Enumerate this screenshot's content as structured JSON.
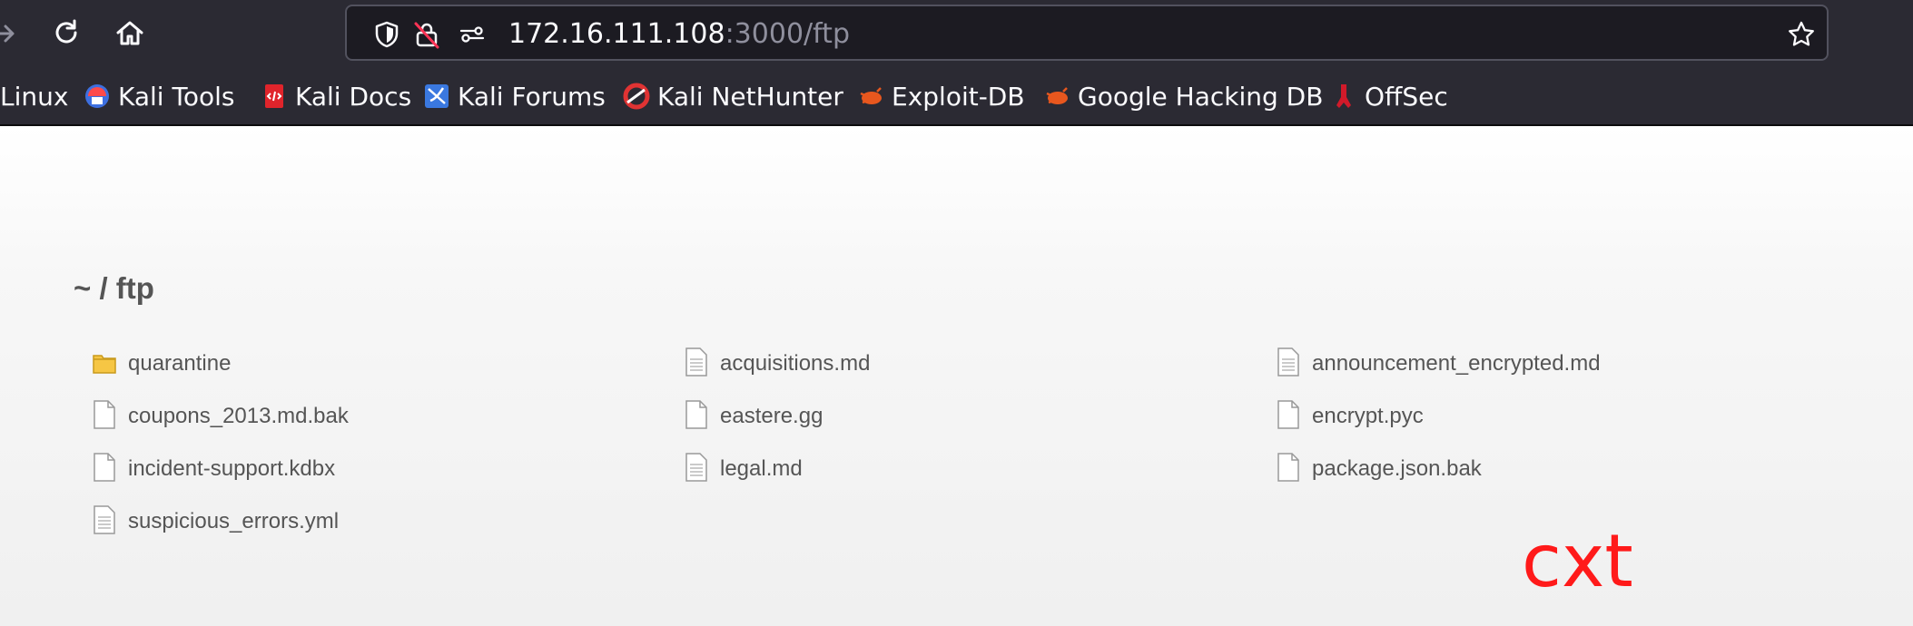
{
  "browser": {
    "nav": [
      "forward-arrow-icon",
      "reload-icon",
      "home-icon"
    ],
    "urlbar": {
      "icons": [
        "tracking-protection-icon",
        "insecure-lock-icon",
        "permissions-icon"
      ],
      "url_host": "172.16.111.108",
      "url_rest": ":3000/ftp",
      "bookmark_star": "star-icon"
    },
    "bookmarks": [
      {
        "label": "Linux"
      },
      {
        "label": "Kali Tools"
      },
      {
        "label": "Kali Docs"
      },
      {
        "label": "Kali Forums"
      },
      {
        "label": "Kali NetHunter"
      },
      {
        "label": "Exploit-DB"
      },
      {
        "label": "Google Hacking DB"
      },
      {
        "label": "OffSec"
      }
    ]
  },
  "listing": {
    "breadcrumb": "~ / ftp",
    "files": [
      {
        "name": "quarantine",
        "icon": "folder-icon"
      },
      {
        "name": "acquisitions.md",
        "icon": "text-file-icon"
      },
      {
        "name": "announcement_encrypted.md",
        "icon": "text-file-icon"
      },
      {
        "name": "coupons_2013.md.bak",
        "icon": "file-icon"
      },
      {
        "name": "eastere.gg",
        "icon": "file-icon"
      },
      {
        "name": "encrypt.pyc",
        "icon": "file-icon"
      },
      {
        "name": "incident-support.kdbx",
        "icon": "file-icon"
      },
      {
        "name": "legal.md",
        "icon": "text-file-icon"
      },
      {
        "name": "package.json.bak",
        "icon": "file-icon"
      },
      {
        "name": "suspicious_errors.yml",
        "icon": "text-file-icon"
      }
    ]
  },
  "watermark": "cxt",
  "colors": {
    "toolbar_bg": "#2b2a33",
    "urlbar_bg": "#1c1b22",
    "page_text": "#555555",
    "watermark": "#ff1a1a"
  }
}
